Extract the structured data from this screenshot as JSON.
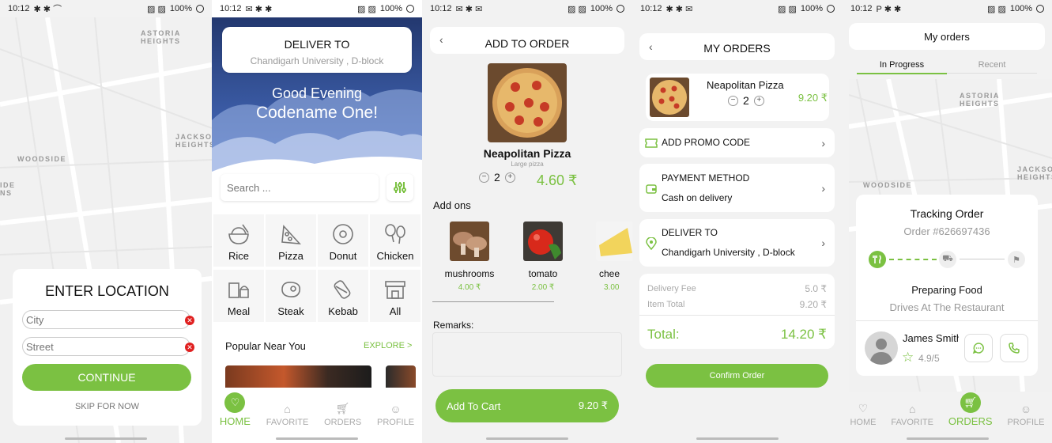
{
  "status_time": "10:12",
  "status_battery": "100%",
  "screen1": {
    "map_labels": {
      "astoria": "ASTORIA\nHEIGHTS",
      "jackson": "JACKSO\nHEIGHTS",
      "woodside": "WOODSIDE",
      "ide": "IDE\nNS"
    },
    "title": "ENTER LOCATION",
    "city_placeholder": "City",
    "street_placeholder": "Street",
    "continue_label": "CONTINUE",
    "skip_label": "SKIP FOR NOW"
  },
  "screen2": {
    "deliver_title": "DELIVER TO",
    "deliver_address": "Chandigarh University , D-block",
    "greeting": "Good Evening",
    "name": "Codename One!",
    "search_placeholder": "Search ...",
    "categories": [
      {
        "label": "Rice",
        "icon": "rice-bowl-icon"
      },
      {
        "label": "Pizza",
        "icon": "pizza-icon"
      },
      {
        "label": "Donut",
        "icon": "donut-icon"
      },
      {
        "label": "Chicken",
        "icon": "chicken-leg-icon"
      },
      {
        "label": "Meal",
        "icon": "meal-icon"
      },
      {
        "label": "Steak",
        "icon": "steak-icon"
      },
      {
        "label": "Kebab",
        "icon": "kebab-icon"
      },
      {
        "label": "All",
        "icon": "store-icon"
      }
    ],
    "popular_title": "Popular Near You",
    "explore_label": "EXPLORE >"
  },
  "nav": {
    "home": "HOME",
    "favorite": "FAVORITE",
    "orders": "ORDERS",
    "profile": "PROFILE"
  },
  "screen3": {
    "title": "ADD TO ORDER",
    "product_name": "Neapolitan Pizza",
    "product_size": "Large pizza",
    "quantity": "2",
    "price": "4.60 ₹",
    "addons_title": "Add ons",
    "addons": [
      {
        "name": "mushrooms",
        "price": "4.00 ₹"
      },
      {
        "name": "tomato",
        "price": "2.00 ₹"
      },
      {
        "name": "chee",
        "price": "3.00"
      }
    ],
    "remarks_label": "Remarks:",
    "add_to_cart_label": "Add To Cart",
    "cart_total": "9.20 ₹"
  },
  "screen4": {
    "title": "MY ORDERS",
    "item_name": "Neapolitan Pizza",
    "item_qty": "2",
    "item_price": "9.20 ₹",
    "promo_label": "ADD PROMO CODE",
    "payment_title": "PAYMENT METHOD",
    "payment_value": "Cash on delivery",
    "deliver_title": "DELIVER TO",
    "deliver_address": "Chandigarh University , D-block",
    "delivery_fee_label": "Delivery Fee",
    "delivery_fee": "5.0 ₹",
    "item_total_label": "Item Total",
    "item_total": "9.20 ₹",
    "total_label": "Total:",
    "total": "14.20 ₹",
    "confirm_label": "Confirm Order"
  },
  "screen5": {
    "title": "My orders",
    "tab_progress": "In Progress",
    "tab_recent": "Recent",
    "map_labels": {
      "astoria": "ASTORIA\nHEIGHTS",
      "jackson": "JACKSO\nHEIGHTS",
      "woodside": "WOODSIDE"
    },
    "tracking_title": "Tracking Order",
    "order_number": "Order #626697436",
    "stage": "Preparing Food",
    "stage_detail": "Drives At The Restaurant",
    "driver_name": "James Smith",
    "driver_rating": "4.9/5"
  },
  "colors": {
    "accent": "#7bc142",
    "sky_dark": "#23386f",
    "sky_light": "#4b72c6"
  }
}
